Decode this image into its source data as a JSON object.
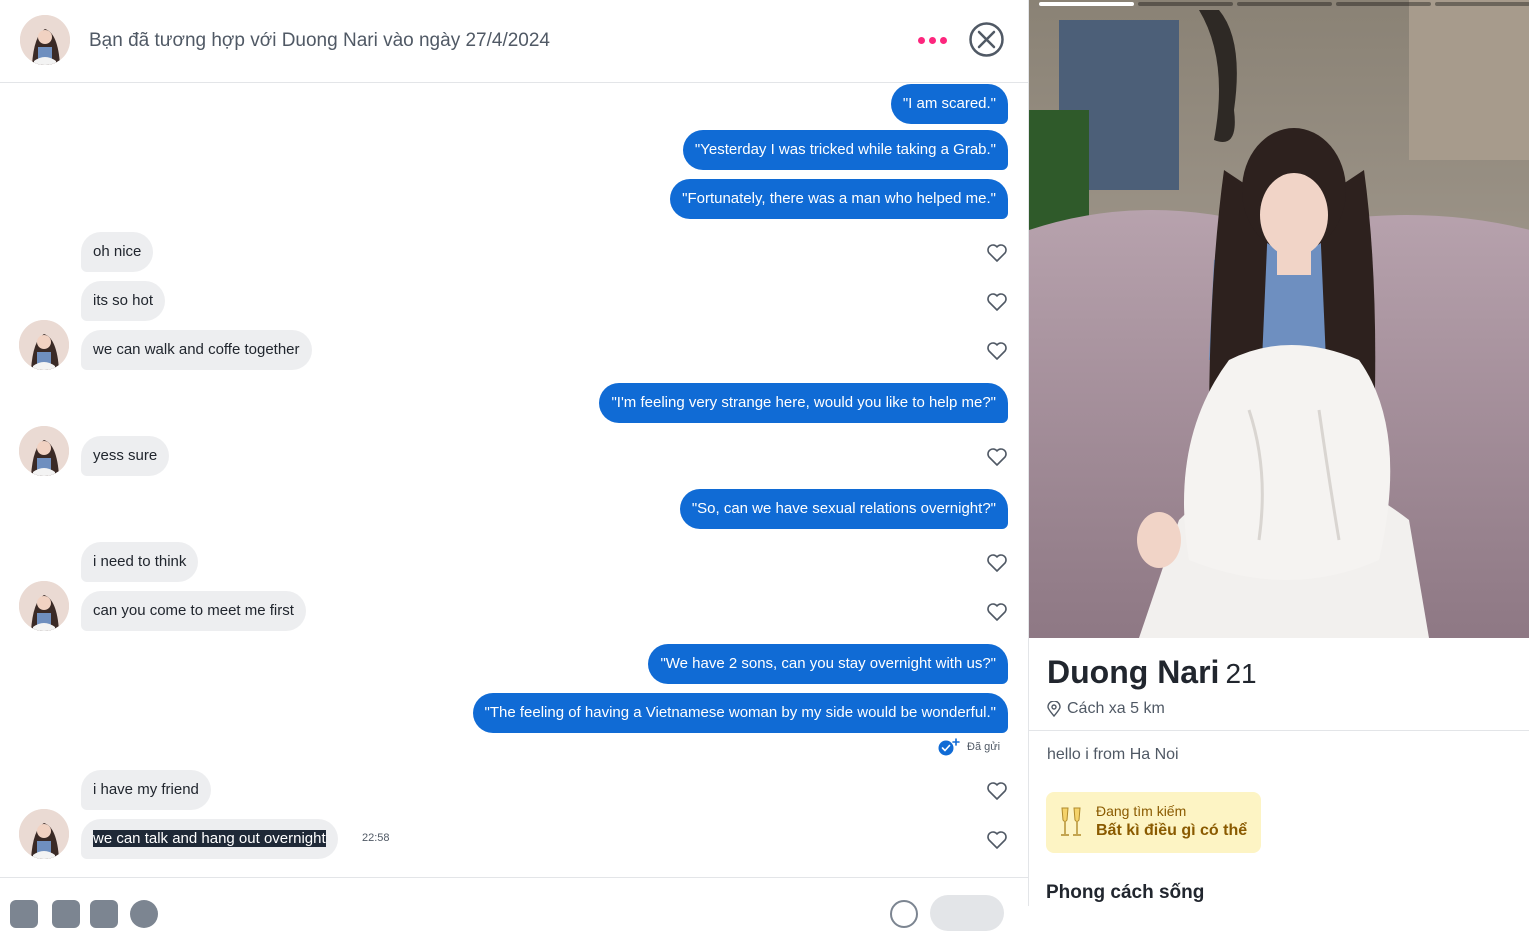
{
  "header": {
    "match_text": "Bạn đã tương hợp với Duong Nari vào ngày 27/4/2024"
  },
  "messages": [
    {
      "dir": "out",
      "text": "\"I am scared.\""
    },
    {
      "dir": "out",
      "text": "\"Yesterday I was tricked while taking a Grab.\""
    },
    {
      "dir": "out",
      "text": "\"Fortunately, there was a man who helped me.\""
    },
    {
      "dir": "in",
      "text": "oh nice"
    },
    {
      "dir": "in",
      "text": "its so hot"
    },
    {
      "dir": "in",
      "text": "we can walk and coffe together"
    },
    {
      "dir": "out",
      "text": "\"I'm feeling very strange here, would you like to help me?\""
    },
    {
      "dir": "in",
      "text": "yess sure"
    },
    {
      "dir": "out",
      "text": "\"So, can we have sexual relations overnight?\""
    },
    {
      "dir": "in",
      "text": "i need to think"
    },
    {
      "dir": "in",
      "text": "can you come to meet me first"
    },
    {
      "dir": "out",
      "text": "\"We have 2 sons, can you stay overnight with us?\""
    },
    {
      "dir": "out",
      "text": "\"The feeling of having a Vietnamese woman by my side would be wonderful.\""
    },
    {
      "dir": "in",
      "text": "i have my friend"
    },
    {
      "dir": "in",
      "text": "we can talk and hang out overnight"
    }
  ],
  "sent_status": "Đã gửi",
  "last_time": "22:58",
  "profile": {
    "name": "Duong Nari",
    "age": "21",
    "distance": "Cách xa 5 km",
    "bio": "hello i from Ha Noi",
    "looking_for_label": "Đang tìm kiếm",
    "looking_for_value": "Bất kì điều gì có thể",
    "lifestyle_title": "Phong cách sống",
    "photo_count": 5,
    "active_photo": 1
  },
  "colors": {
    "outgoing_bubble": "#106bd5",
    "incoming_bubble": "#edeef0",
    "accent_dots": "#fd267d",
    "looking_card_bg": "#fdf4c4"
  },
  "icons": [
    "more-dots-icon",
    "close-circle-icon",
    "heart-icon",
    "sent-check-icon",
    "location-pin-icon",
    "champagne-icon"
  ]
}
